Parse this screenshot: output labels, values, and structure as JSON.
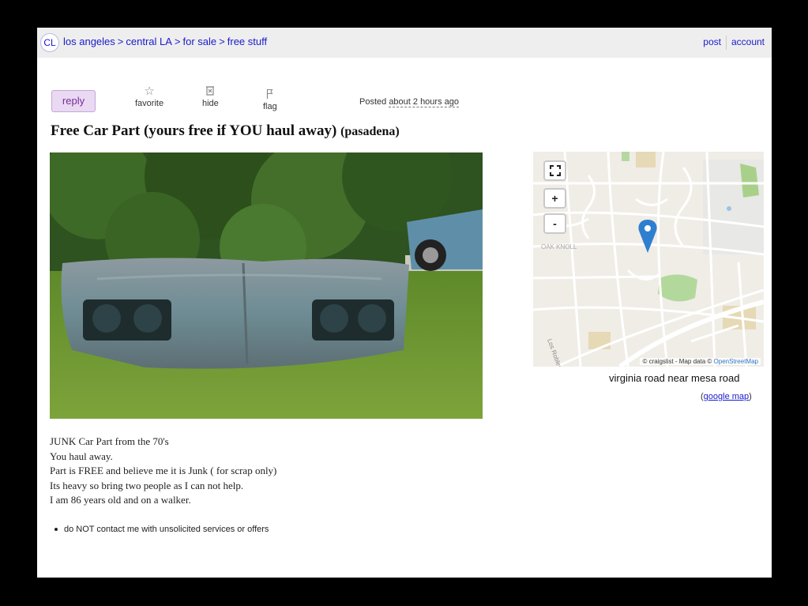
{
  "header": {
    "logo": "CL",
    "breadcrumbs": [
      "los angeles",
      "central LA",
      "for sale",
      "free stuff"
    ],
    "separator": ">",
    "post_label": "post",
    "account_label": "account"
  },
  "actions": {
    "reply_label": "reply",
    "favorite_label": "favorite",
    "hide_label": "hide",
    "flag_label": "flag",
    "posted_prefix": "Posted",
    "posted_ago": "about 2 hours ago"
  },
  "listing": {
    "title": "Free Car Part (yours free if YOU haul away)",
    "location": "(pasadena)",
    "body_lines": [
      "JUNK Car Part from the 70's",
      "You haul away.",
      "Part is FREE and believe me it is Junk ( for scrap only)",
      "Its heavy so bring two people as I can not help.",
      "I am 86 years old and on a walker."
    ],
    "notice": "do NOT contact me with unsolicited services or offers"
  },
  "map": {
    "fullscreen_icon": "fullscreen-icon",
    "zoom_in_label": "+",
    "zoom_out_label": "-",
    "place_label": "OAK KNOLL",
    "street_label": "Los Robles",
    "attribution_prefix": "© craigslist - Map data ©",
    "attribution_link": "OpenStreetMap",
    "location_text": "virginia road near mesa road",
    "google_map_label": "google map",
    "pin_color": "#2f7fd1"
  }
}
